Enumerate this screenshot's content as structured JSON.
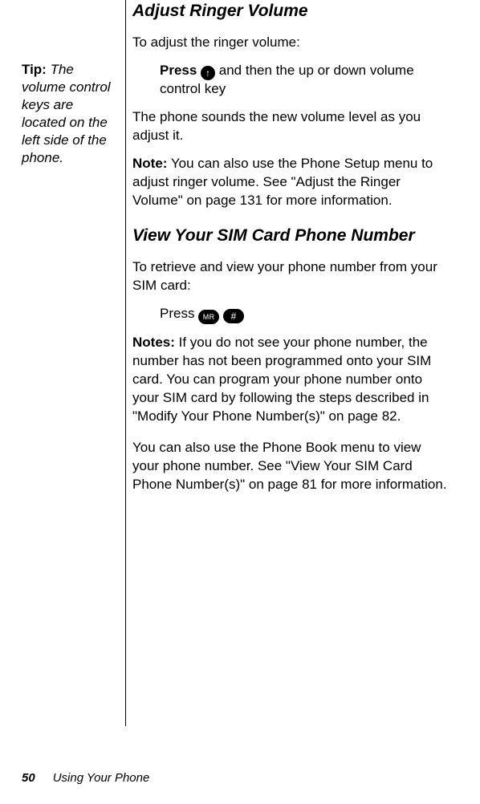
{
  "sidebar": {
    "tip_label": "Tip:",
    "tip_text": " The volume control keys are located on the left side of the phone."
  },
  "main": {
    "sec1": {
      "heading": "Adjust Ringer Volume",
      "intro": "To adjust the ringer volume:",
      "press_bold": "Press ",
      "key_arrow": "↑",
      "press_rest": " and then the up or down volume control key",
      "para2": "The phone sounds the new volume level as you adjust it.",
      "note_label": "Note:",
      "note_text": " You can also use the Phone Setup menu to adjust ringer volume. See \"Adjust the Ringer Volume\" on page 131 for more information."
    },
    "sec2": {
      "heading": "View Your SIM Card Phone Number",
      "intro": "To retrieve and view your phone number from your SIM card:",
      "press_label": "Press ",
      "key1": "MR",
      "key2": "#",
      "notes_label": "Notes:",
      "notes_text": " If you do not see your phone number, the number has not been programmed onto your SIM card. You can program your phone number onto your SIM card by following the steps described in \"Modify Your Phone Number(s)\" on page 82.",
      "para_last": "You can also use the Phone Book menu to view your phone number. See \"View Your SIM Card Phone Number(s)\" on page 81 for more information."
    }
  },
  "footer": {
    "page_number": "50",
    "section_title": "Using Your Phone"
  }
}
